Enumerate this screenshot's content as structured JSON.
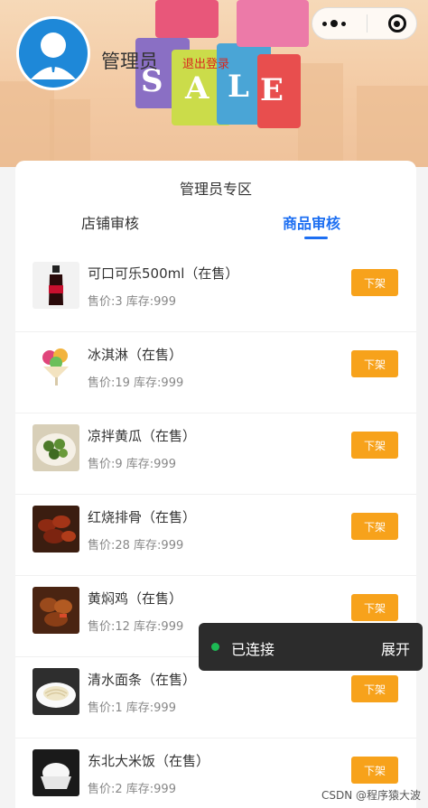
{
  "header": {
    "avatar_icon": "user-avatar-icon",
    "admin_name": "管理员",
    "logout_label": "退出登录",
    "banner_word": "SALE",
    "capsule": {
      "menu_icon": "more-dots-icon",
      "close_icon": "capsule-close-icon"
    }
  },
  "panel": {
    "title": "管理员专区",
    "tabs": [
      {
        "label": "店铺审核",
        "active": false
      },
      {
        "label": "商品审核",
        "active": true
      }
    ]
  },
  "products": [
    {
      "name": "可口可乐500ml（在售）",
      "meta": "售价:3 库存:999",
      "action": "下架",
      "thumb_icon": "cola-bottle-icon"
    },
    {
      "name": "冰淇淋（在售）",
      "meta": "售价:19 库存:999",
      "action": "下架",
      "thumb_icon": "ice-cream-icon"
    },
    {
      "name": "凉拌黄瓜（在售）",
      "meta": "售价:9 库存:999",
      "action": "下架",
      "thumb_icon": "cucumber-dish-icon"
    },
    {
      "name": "红烧排骨（在售）",
      "meta": "售价:28 库存:999",
      "action": "下架",
      "thumb_icon": "braised-ribs-icon"
    },
    {
      "name": "黄焖鸡（在售）",
      "meta": "售价:12 库存:999",
      "action": "下架",
      "thumb_icon": "braised-chicken-icon"
    },
    {
      "name": "清水面条（在售）",
      "meta": "售价:1 库存:999",
      "action": "下架",
      "thumb_icon": "noodles-icon"
    },
    {
      "name": "东北大米饭（在售）",
      "meta": "售价:2 库存:999",
      "action": "下架",
      "thumb_icon": "rice-bowl-icon"
    }
  ],
  "toast": {
    "status": "已连接",
    "expand_label": "展开"
  },
  "watermark": "CSDN @程序猿大波",
  "colors": {
    "accent": "#1d6ff2",
    "button": "#f7a21b",
    "logout": "#d9281e"
  }
}
